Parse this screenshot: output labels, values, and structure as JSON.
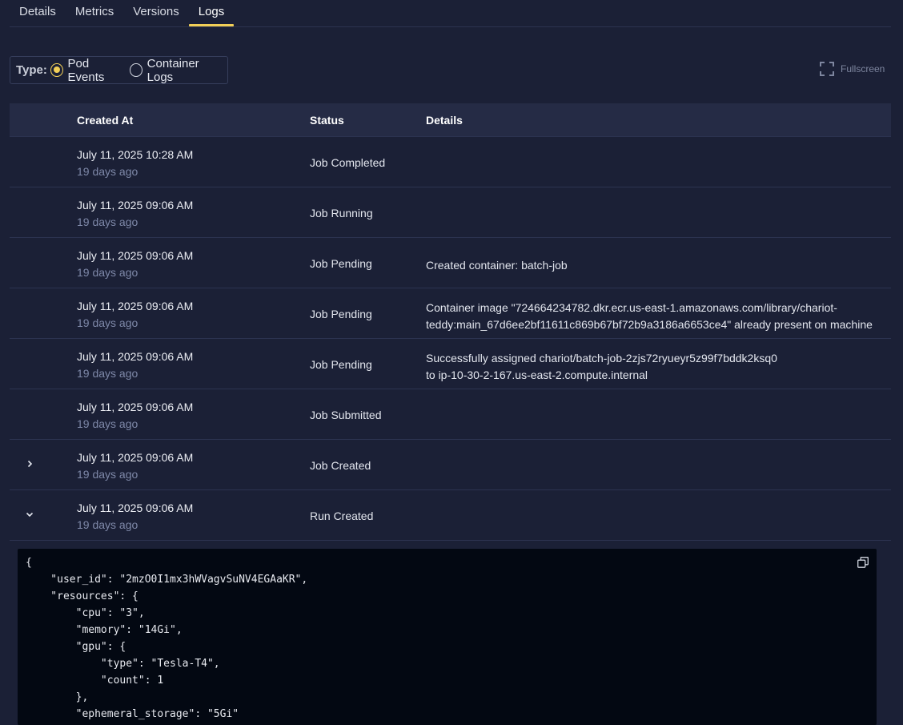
{
  "tabs": [
    {
      "label": "Details"
    },
    {
      "label": "Metrics"
    },
    {
      "label": "Versions"
    },
    {
      "label": "Logs",
      "active": true
    }
  ],
  "type_filter": {
    "label": "Type:",
    "options": [
      {
        "label": "Pod Events",
        "checked": true
      },
      {
        "label": "Container Logs",
        "checked": false
      }
    ]
  },
  "fullscreen": {
    "label": "Fullscreen",
    "icon": "fullscreen-icon"
  },
  "table": {
    "headers": {
      "created_at": "Created At",
      "status": "Status",
      "details": "Details"
    },
    "rows": [
      {
        "date": "July 11, 2025 10:28 AM",
        "relative": "19 days ago",
        "status": "Job Completed",
        "details": []
      },
      {
        "date": "July 11, 2025 09:06 AM",
        "relative": "19 days ago",
        "status": "Job Running",
        "details": []
      },
      {
        "date": "July 11, 2025 09:06 AM",
        "relative": "19 days ago",
        "status": "Job Pending",
        "details": [
          "Created container: batch-job"
        ]
      },
      {
        "date": "July 11, 2025 09:06 AM",
        "relative": "19 days ago",
        "status": "Job Pending",
        "details": [
          "Container image \"724664234782.dkr.ecr.us-east-1.amazonaws.com/library/chariot-",
          "teddy:main_67d6ee2bf11611c869b67bf72b9a3186a6653ce4\" already present on machine"
        ]
      },
      {
        "date": "July 11, 2025 09:06 AM",
        "relative": "19 days ago",
        "status": "Job Pending",
        "details": [
          "Successfully assigned chariot/batch-job-2zjs72ryueyr5z99f7bddk2ksq0",
          "to ip-10-30-2-167.us-east-2.compute.internal"
        ]
      },
      {
        "date": "July 11, 2025 09:06 AM",
        "relative": "19 days ago",
        "status": "Job Submitted",
        "details": []
      },
      {
        "date": "July 11, 2025 09:06 AM",
        "relative": "19 days ago",
        "status": "Job Created",
        "details": [],
        "expander": "chevron-right-icon"
      },
      {
        "date": "July 11, 2025 09:06 AM",
        "relative": "19 days ago",
        "status": "Run Created",
        "details": [],
        "expander": "chevron-down-icon"
      }
    ]
  },
  "code_block": {
    "copy_icon": "copy-icon",
    "text": "{\n    \"user_id\": \"2mzO0I1mx3hWVagvSuNV4EGAaKR\",\n    \"resources\": {\n        \"cpu\": \"3\",\n        \"memory\": \"14Gi\",\n        \"gpu\": {\n            \"type\": \"Tesla-T4\",\n            \"count\": 1\n        },\n        \"ephemeral_storage\": \"5Gi\""
  },
  "colors": {
    "accent": "#f2cf57",
    "background": "#1b2036",
    "header_bg": "#252b45",
    "code_bg": "#030812"
  }
}
